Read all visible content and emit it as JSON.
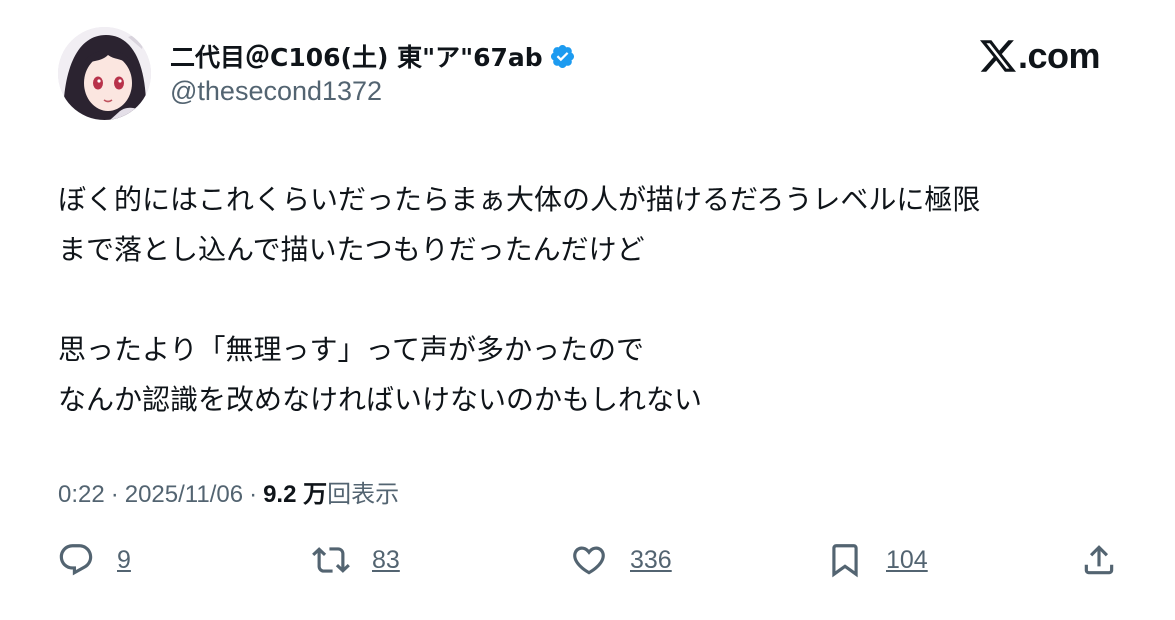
{
  "author": {
    "display_name": "二代目＠C106(土) 東\"ア\"67ab",
    "handle": "@thesecond1372",
    "verified_icon": "verified-badge-icon",
    "avatar": "anime-girl-avatar"
  },
  "brand": {
    "logo": "x-logo-icon",
    "suffix": ".com"
  },
  "tweet": {
    "lines": [
      "ぼく的にはこれくらいだったらまぁ大体の人が描けるだろうレベルに極限",
      "まで落とし込んで描いたつもりだったんだけど",
      "思ったより「無理っす」って声が多かったので",
      "なんか認識を改めなければいけないのかもしれない"
    ]
  },
  "meta": {
    "time": "0:22",
    "separator": "·",
    "date": "2025/11/06",
    "views_count": "9.2 万",
    "views_label": "回表示"
  },
  "actions": {
    "reply": {
      "icon": "reply-icon",
      "count": "9"
    },
    "retweet": {
      "icon": "retweet-icon",
      "count": "83"
    },
    "like": {
      "icon": "heart-icon",
      "count": "336"
    },
    "bookmark": {
      "icon": "bookmark-icon",
      "count": "104"
    },
    "share": {
      "icon": "share-icon"
    }
  },
  "colors": {
    "text": "#0f1419",
    "secondary": "#536471",
    "verified": "#1d9bf0"
  }
}
